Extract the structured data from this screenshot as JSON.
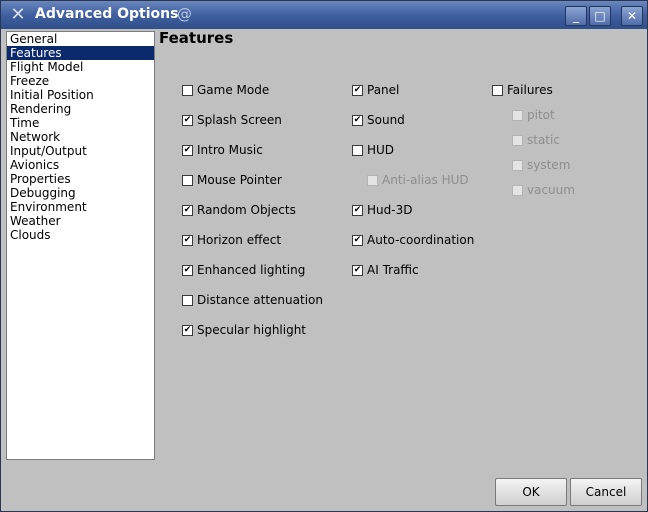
{
  "window": {
    "title": "Advanced Options",
    "app_icon": "x-icon",
    "controls": {
      "minimize": "_",
      "maximize": "□",
      "close": "✕"
    }
  },
  "sidebar": {
    "items": [
      {
        "label": "General"
      },
      {
        "label": "Features",
        "selected": true
      },
      {
        "label": "Flight Model"
      },
      {
        "label": "Freeze"
      },
      {
        "label": "Initial Position"
      },
      {
        "label": "Rendering"
      },
      {
        "label": "Time"
      },
      {
        "label": "Network"
      },
      {
        "label": "Input/Output"
      },
      {
        "label": "Avionics"
      },
      {
        "label": "Properties"
      },
      {
        "label": "Debugging"
      },
      {
        "label": "Environment"
      },
      {
        "label": "Weather"
      },
      {
        "label": "Clouds"
      }
    ]
  },
  "panel": {
    "title": "Features",
    "col1": [
      {
        "label": "Game Mode",
        "checked": false
      },
      {
        "label": "Splash Screen",
        "checked": true
      },
      {
        "label": "Intro Music",
        "checked": true
      },
      {
        "label": "Mouse Pointer",
        "checked": false
      },
      {
        "label": "Random Objects",
        "checked": true
      },
      {
        "label": "Horizon effect",
        "checked": true
      },
      {
        "label": "Enhanced lighting",
        "checked": true
      },
      {
        "label": "Distance attenuation",
        "checked": false
      },
      {
        "label": "Specular highlight",
        "checked": true
      }
    ],
    "col2": [
      {
        "label": "Panel",
        "checked": true
      },
      {
        "label": "Sound",
        "checked": true
      },
      {
        "label": "HUD",
        "checked": false
      },
      {
        "label": "Anti-alias HUD",
        "checked": false,
        "disabled": true
      },
      {
        "label": "Hud-3D",
        "checked": true
      },
      {
        "label": "Auto-coordination",
        "checked": true
      },
      {
        "label": "AI Traffic",
        "checked": true
      }
    ],
    "col3": [
      {
        "label": "Failures",
        "checked": false
      },
      {
        "label": "pitot",
        "checked": false,
        "disabled": true
      },
      {
        "label": "static",
        "checked": false,
        "disabled": true
      },
      {
        "label": "system",
        "checked": false,
        "disabled": true
      },
      {
        "label": "vacuum",
        "checked": false,
        "disabled": true
      }
    ]
  },
  "buttons": {
    "ok": "OK",
    "cancel": "Cancel"
  }
}
